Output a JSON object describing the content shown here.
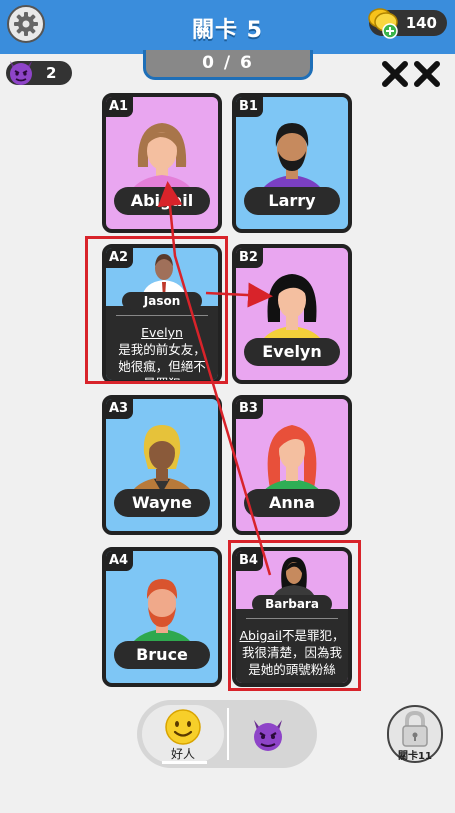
{
  "header": {
    "title": "關卡 5",
    "coins": "140",
    "progress": "0 / 6",
    "demon_count": "2"
  },
  "cards": [
    {
      "id": "A1",
      "name": "Abigail",
      "color": "pink"
    },
    {
      "id": "B1",
      "name": "Larry",
      "color": "blue"
    },
    {
      "id": "A2",
      "name": "Jason",
      "color": "blue",
      "clue_name": "Evelyn",
      "clue_text": "是我的前女友，她很瘋，但絕不是罪犯"
    },
    {
      "id": "B2",
      "name": "Evelyn",
      "color": "pink"
    },
    {
      "id": "A3",
      "name": "Wayne",
      "color": "blue"
    },
    {
      "id": "B3",
      "name": "Anna",
      "color": "pink"
    },
    {
      "id": "A4",
      "name": "Bruce",
      "color": "blue"
    },
    {
      "id": "B4",
      "name": "Barbara",
      "color": "pink",
      "clue_name": "Abigail",
      "clue_text": "不是罪犯，我很清楚，因為我是她的頭號粉絲"
    }
  ],
  "bottom": {
    "good_label": "好人",
    "lock_label": "關卡11"
  },
  "colors": {
    "accent_blue": "#3a8ddc",
    "highlight_red": "#d8232a",
    "card_pink": "#e9a6f0",
    "card_blue": "#7ec6f5"
  }
}
